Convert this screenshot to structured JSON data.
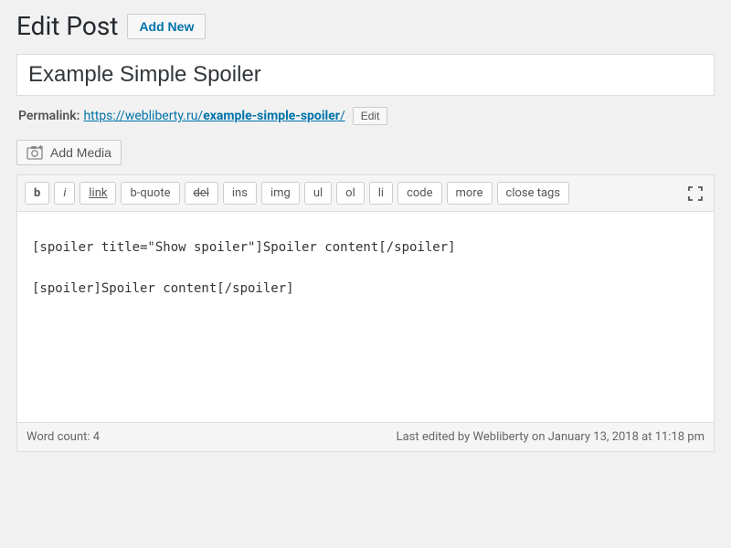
{
  "header": {
    "page_title": "Edit Post",
    "add_new_label": "Add New"
  },
  "title_input": {
    "value": "Example Simple Spoiler"
  },
  "permalink": {
    "label": "Permalink:",
    "base": "https://webliberty.ru/",
    "slug": "example-simple-spoiler",
    "trail": "/",
    "edit_label": "Edit"
  },
  "media_button": {
    "label": "Add Media"
  },
  "toolbar": {
    "b": "b",
    "i": "i",
    "link": "link",
    "bquote": "b-quote",
    "del": "del",
    "ins": "ins",
    "img": "img",
    "ul": "ul",
    "ol": "ol",
    "li": "li",
    "code": "code",
    "more": "more",
    "close": "close tags"
  },
  "editor": {
    "content": "[spoiler title=\"Show spoiler\"]Spoiler content[/spoiler]\n\n[spoiler]Spoiler content[/spoiler]"
  },
  "status": {
    "word_count_label": "Word count: 4",
    "last_edited": "Last edited by Webliberty on January 13, 2018 at 11:18 pm"
  }
}
